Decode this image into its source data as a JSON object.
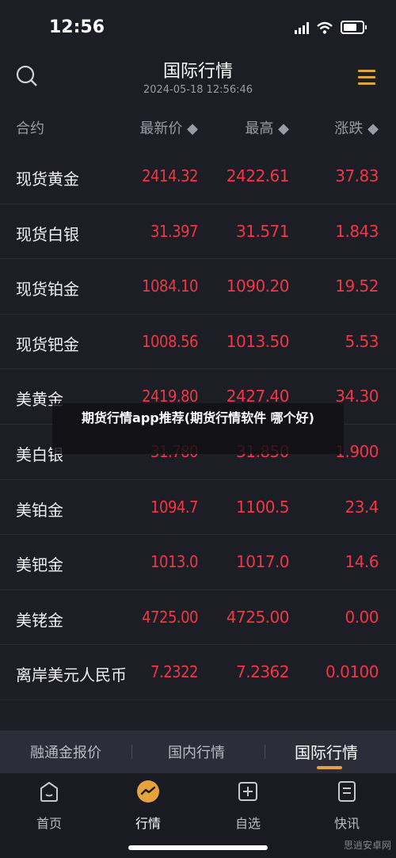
{
  "status": {
    "time": "12:56"
  },
  "header": {
    "title": "国际行情",
    "datetime": "2024-05-18 12:56:46"
  },
  "columns": {
    "name": "合约",
    "price": "最新价 ◆",
    "high": "最高 ◆",
    "change": "涨跌 ◆"
  },
  "rows": [
    {
      "name": "现货黄金",
      "price": "2414.32",
      "high": "2422.61",
      "change": "37.83"
    },
    {
      "name": "现货白银",
      "price": "31.397",
      "high": "31.571",
      "change": "1.843"
    },
    {
      "name": "现货铂金",
      "price": "1084.10",
      "high": "1090.20",
      "change": "19.52"
    },
    {
      "name": "现货钯金",
      "price": "1008.56",
      "high": "1013.50",
      "change": "5.53"
    },
    {
      "name": "美黄金",
      "price": "2419.80",
      "high": "2427.40",
      "change": "34.30"
    },
    {
      "name": "美白银",
      "price": "31.780",
      "high": "31.850",
      "change": "1.900"
    },
    {
      "name": "美铂金",
      "price": "1094.7",
      "high": "1100.5",
      "change": "23.4"
    },
    {
      "name": "美钯金",
      "price": "1013.0",
      "high": "1017.0",
      "change": "14.6"
    },
    {
      "name": "美铑金",
      "price": "4725.00",
      "high": "4725.00",
      "change": "0.00"
    },
    {
      "name": "离岸美元人民币",
      "price": "7.2322",
      "high": "7.2362",
      "change": "0.0100"
    }
  ],
  "overlay": {
    "text": "期货行情app推荐(期货行情软件 哪个好)"
  },
  "subtabs": [
    "融通金报价",
    "国内行情",
    "国际行情"
  ],
  "nav": [
    "首页",
    "行情",
    "自选",
    "快讯"
  ],
  "watermark": "思逍安卓网",
  "colors": {
    "up": "#f23645",
    "accent": "#e6a23c",
    "background": "#1c1d25"
  }
}
